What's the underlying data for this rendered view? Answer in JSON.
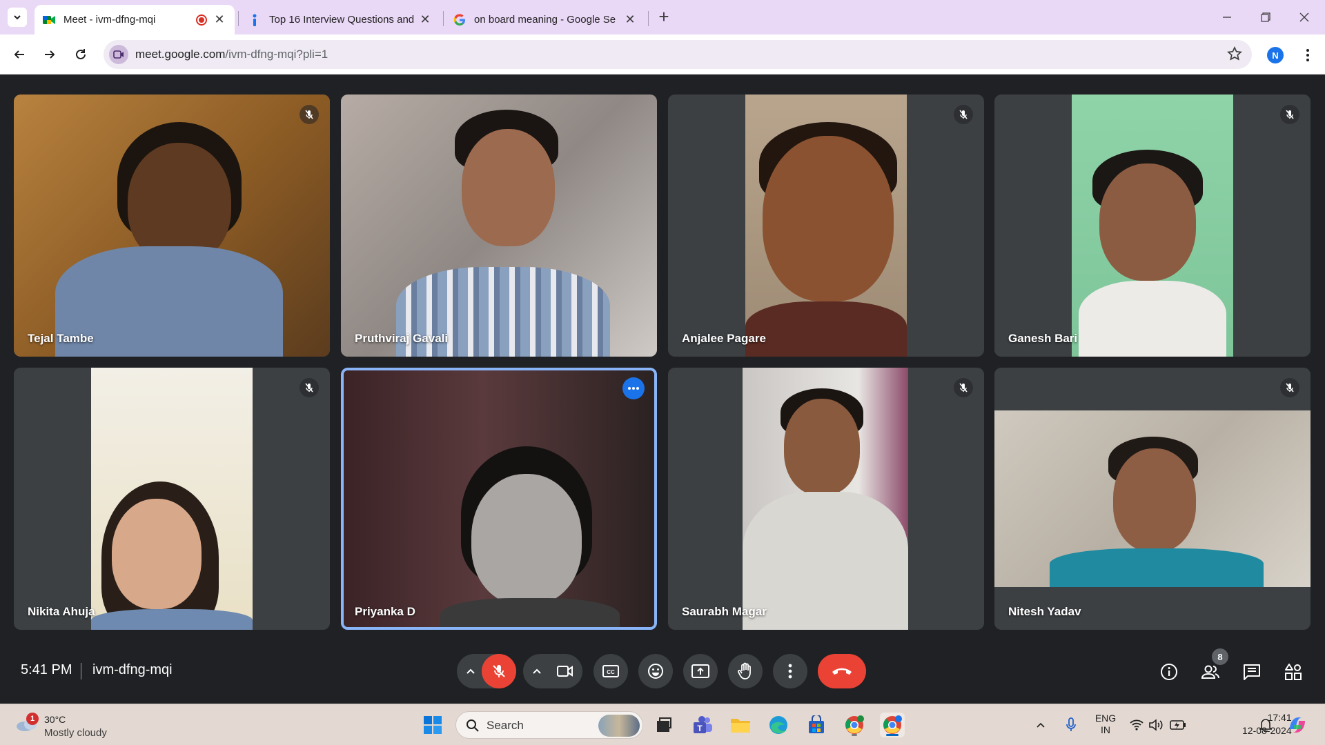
{
  "browser": {
    "tabs": [
      {
        "title": "Meet - ivm-dfng-mqi",
        "active": true,
        "recording": true
      },
      {
        "title": "Top 16 Interview Questions and",
        "active": false
      },
      {
        "title": "on board meaning - Google Se",
        "active": false
      }
    ],
    "url_host": "meet.google.com",
    "url_path": "/ivm-dfng-mqi?pli=1",
    "profile_initial": "N",
    "close_glyph": "✕",
    "new_tab_glyph": "+"
  },
  "meet": {
    "participants": [
      {
        "name": "Tejal Tambe",
        "muted": true
      },
      {
        "name": "Pruthviraj Gavali",
        "muted": false
      },
      {
        "name": "Anjalee Pagare",
        "muted": true
      },
      {
        "name": "Ganesh Bari",
        "muted": true
      },
      {
        "name": "Nikita Ahuja",
        "muted": true
      },
      {
        "name": "Priyanka D",
        "muted": false,
        "speaking": true
      },
      {
        "name": "Saurabh Magar",
        "muted": true
      },
      {
        "name": "Nitesh Yadav",
        "muted": true
      }
    ],
    "time": "5:41 PM",
    "meeting_code": "ivm-dfng-mqi",
    "people_count": "8",
    "colors": {
      "end_call": "#ea4335",
      "mic_off": "#ea4335",
      "speaking_border": "#8ab4f8",
      "accent": "#1a73e8"
    }
  },
  "taskbar": {
    "weather_temp": "30°C",
    "weather_condition": "Mostly cloudy",
    "weather_alert_count": "1",
    "search_placeholder": "Search",
    "language_line1": "ENG",
    "language_line2": "IN",
    "clock_time": "17:41",
    "clock_date": "12-08-2024"
  }
}
